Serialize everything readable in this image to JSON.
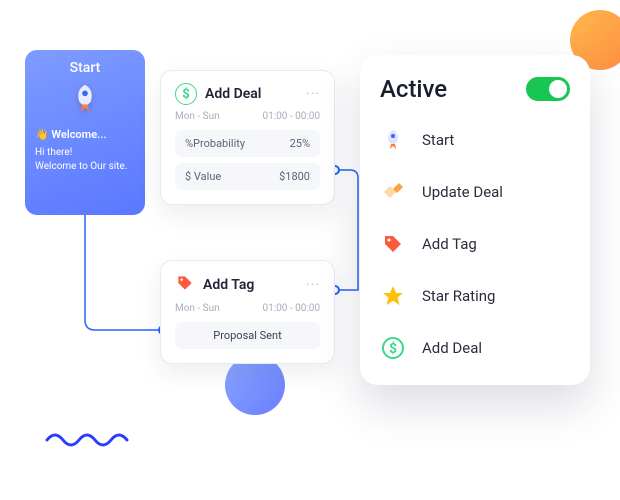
{
  "start": {
    "title": "Start",
    "welcome_row": "👋 Welcome...",
    "hi": "Hi there!",
    "sub": "Welcome to Our site."
  },
  "deal": {
    "title": "Add Deal",
    "days": "Mon - Sun",
    "time": "01:00 - 00:00",
    "prob_label": "%Probability",
    "prob_value": "25%",
    "value_label": "$ Value",
    "value_amount": "$1800"
  },
  "tag": {
    "title": "Add Tag",
    "days": "Mon - Sun",
    "time": "01:00 - 00:00",
    "status": "Proposal Sent"
  },
  "active": {
    "title": "Active",
    "items": [
      {
        "label": "Start"
      },
      {
        "label": "Update Deal"
      },
      {
        "label": "Add Tag"
      },
      {
        "label": "Star Rating"
      },
      {
        "label": "Add Deal"
      }
    ]
  }
}
